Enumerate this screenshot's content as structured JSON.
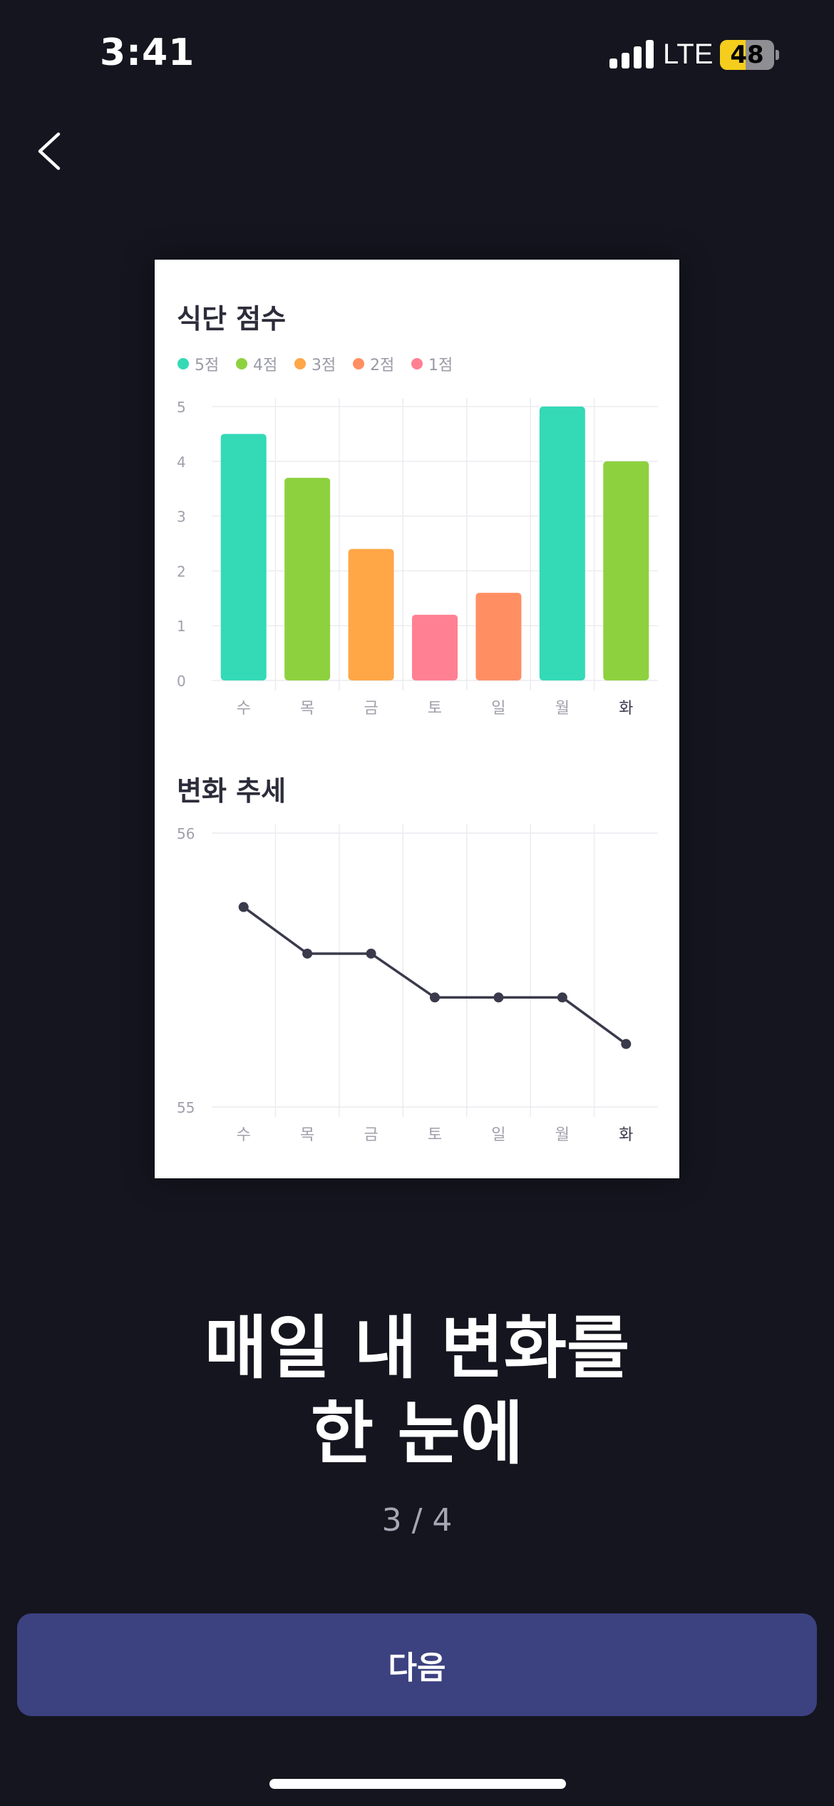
{
  "status_bar": {
    "time": "3:41",
    "network": "LTE",
    "battery_level": 48,
    "battery_text": "48"
  },
  "back_icon": "chevron-left-icon",
  "card": {
    "diet_title": "식단 점수",
    "trend_title": "변화 추세"
  },
  "legend": [
    {
      "label": "5점",
      "color": "#34d9b6"
    },
    {
      "label": "4점",
      "color": "#8ed13f"
    },
    {
      "label": "3점",
      "color": "#ffa647"
    },
    {
      "label": "2점",
      "color": "#ff8f63"
    },
    {
      "label": "1점",
      "color": "#ff8093"
    }
  ],
  "chart_data": [
    {
      "type": "bar",
      "title": "식단 점수",
      "categories": [
        "수",
        "목",
        "금",
        "토",
        "일",
        "월",
        "화"
      ],
      "values": [
        4.5,
        3.7,
        2.4,
        1.2,
        1.6,
        5.0,
        4.0
      ],
      "bar_colors": [
        "#34d9b6",
        "#8ed13f",
        "#ffa647",
        "#ff8093",
        "#ff8f63",
        "#34d9b6",
        "#8ed13f"
      ],
      "ylim": [
        0,
        5
      ],
      "yticks": [
        "0",
        "1",
        "2",
        "3",
        "4",
        "5"
      ],
      "grid": true,
      "highlight_category": "화"
    },
    {
      "type": "line",
      "title": "변화 추세",
      "categories": [
        "수",
        "목",
        "금",
        "토",
        "일",
        "월",
        "화"
      ],
      "values": [
        55.73,
        55.56,
        55.56,
        55.4,
        55.4,
        55.4,
        55.23
      ],
      "ylim": [
        55,
        56
      ],
      "yticks": [
        "55",
        "56"
      ],
      "line_color": "#3a3a4c",
      "grid": true,
      "highlight_category": "화"
    }
  ],
  "headline": {
    "line1": "매일 내 변화를",
    "line2": "한 눈에"
  },
  "page_indicator": "3 / 4",
  "next_button": {
    "label": "다음"
  }
}
